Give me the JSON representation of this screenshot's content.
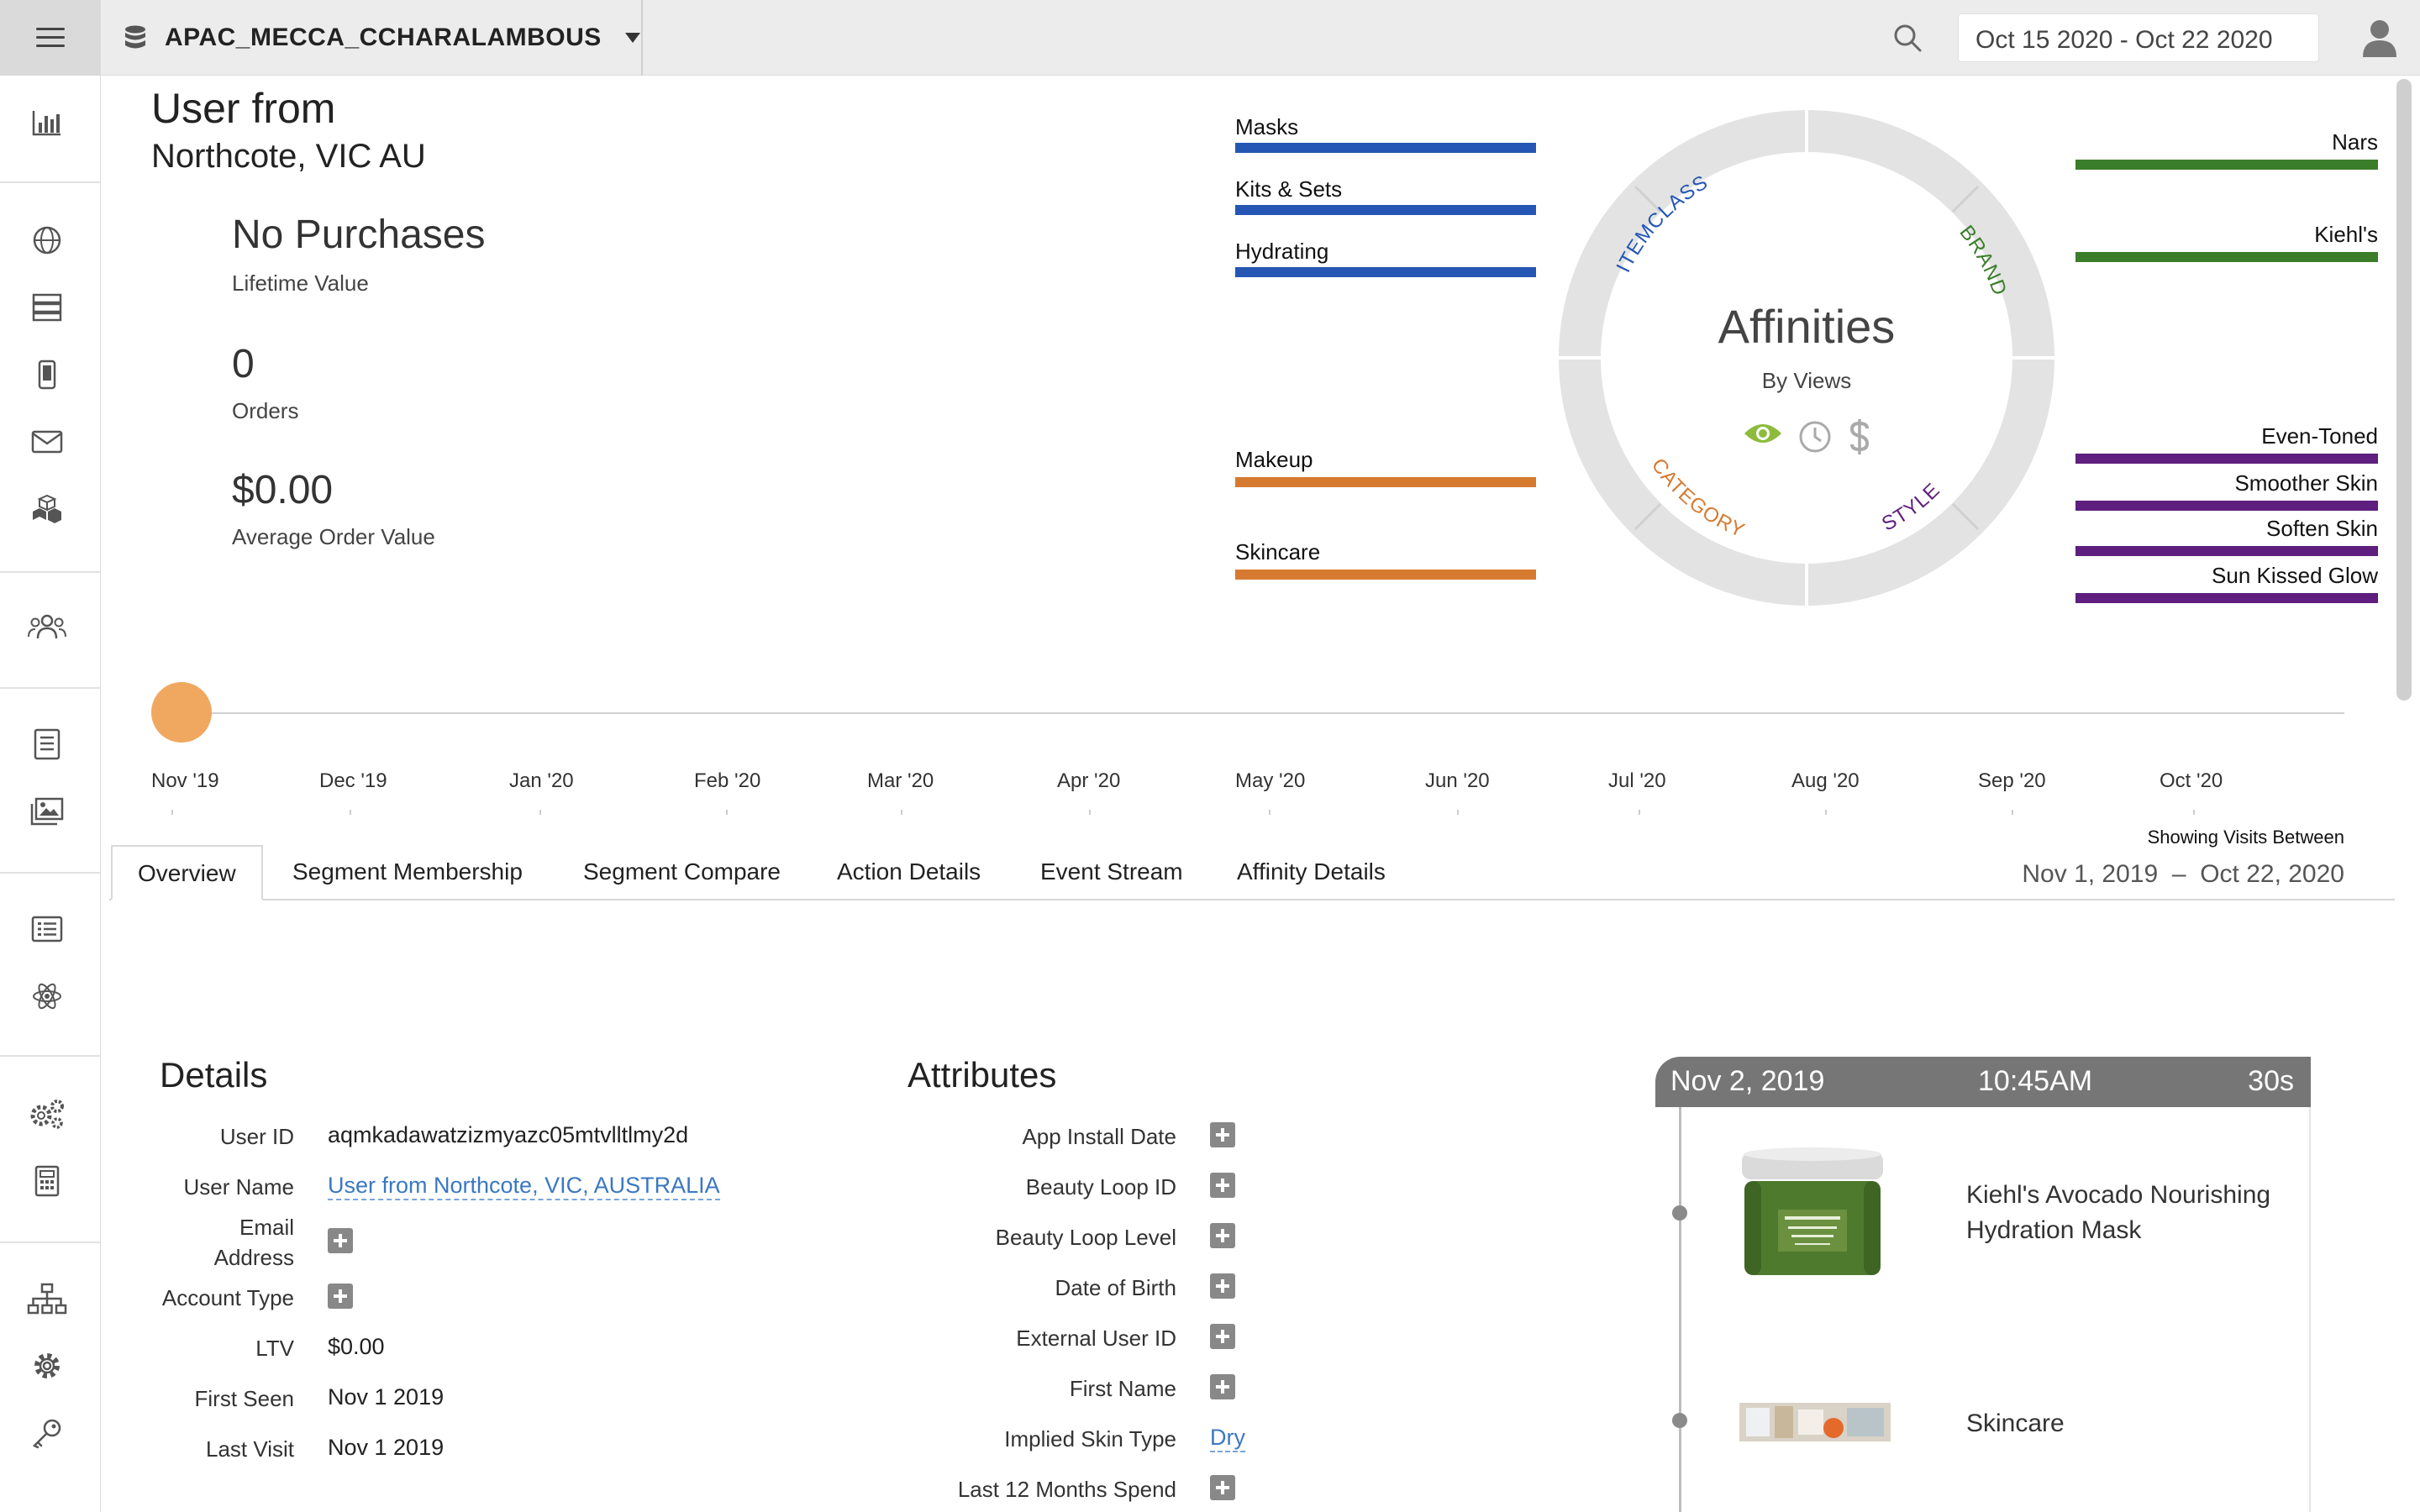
{
  "topbar": {
    "workspace": "APAC_MECCA_CCHARALAMBOUS",
    "date_range": "Oct 15 2020 - Oct 22 2020",
    "icons": [
      "menu-icon",
      "database-icon",
      "search-icon",
      "user-icon"
    ]
  },
  "sidebar": {
    "icons": [
      "bar-chart-icon",
      "globe-icon",
      "server-icon",
      "mobile-icon",
      "mail-icon",
      "cubes-icon",
      "users-icon",
      "document-icon",
      "images-icon",
      "list-icon",
      "atom-icon",
      "gears-icon",
      "calculator-icon",
      "sitemap-icon",
      "gear-icon",
      "key-icon"
    ]
  },
  "profile": {
    "title": "User from",
    "location": "Northcote, VIC AU",
    "stats": [
      {
        "value": "No Purchases",
        "label": "Lifetime Value"
      },
      {
        "value": "0",
        "label": "Orders"
      },
      {
        "value": "$0.00",
        "label": "Average Order Value"
      }
    ]
  },
  "affinities": {
    "title": "Affinities",
    "subtitle": "By Views",
    "ring_labels": {
      "itemclass": "ITEMCLASS",
      "brand": "BRAND",
      "category": "CATEGORY",
      "style": "STYLE"
    },
    "itemclass": [
      "Masks",
      "Kits & Sets",
      "Hydrating"
    ],
    "category": [
      "Makeup",
      "Skincare"
    ],
    "brand": [
      "Nars",
      "Kiehl's"
    ],
    "style": [
      "Even-Toned",
      "Smoother Skin",
      "Soften Skin",
      "Sun Kissed Glow"
    ],
    "colors": {
      "itemclass": "#2556b4",
      "category": "#d67a30",
      "brand": "#3a7d2a",
      "style": "#5e1f7e",
      "active_view": "#8dbb3c"
    },
    "view_icons": [
      "eye-icon",
      "clock-icon",
      "dollar-icon"
    ]
  },
  "timeline": {
    "months": [
      "Nov '19",
      "Dec '19",
      "Jan '20",
      "Feb '20",
      "Mar '20",
      "Apr '20",
      "May '20",
      "Jun '20",
      "Jul '20",
      "Aug '20",
      "Sep '20",
      "Oct '20"
    ]
  },
  "tabs": [
    "Overview",
    "Segment Membership",
    "Segment Compare",
    "Action Details",
    "Event Stream",
    "Affinity Details"
  ],
  "showing": {
    "label": "Showing Visits Between",
    "start": "Nov 1, 2019",
    "sep": "–",
    "end": "Oct 22, 2020"
  },
  "details": {
    "title": "Details",
    "user_id_label": "User ID",
    "user_id": "aqmkadawatzizmyazc05mtvlltlmy2d",
    "user_name_label": "User Name",
    "user_name": "User from Northcote, VIC, AUSTRALIA",
    "email_label_1": "Email",
    "email_label_2": "Address",
    "account_type_label": "Account Type",
    "ltv_label": "LTV",
    "ltv": "$0.00",
    "first_seen_label": "First Seen",
    "first_seen": "Nov 1 2019",
    "last_visit_label": "Last Visit",
    "last_visit": "Nov 1 2019"
  },
  "attributes": {
    "title": "Attributes",
    "rows": [
      "App Install Date",
      "Beauty Loop ID",
      "Beauty Loop Level",
      "Date of Birth",
      "External User ID",
      "First Name",
      "Implied Skin Type",
      "Last 12 Months Spend"
    ],
    "implied_skin_type": "Dry"
  },
  "activity": {
    "date": "Nov 2, 2019",
    "time": "10:45AM",
    "duration": "30s",
    "items": [
      "Kiehl's Avocado Nourishing",
      "Hydration Mask",
      "Skincare"
    ]
  }
}
